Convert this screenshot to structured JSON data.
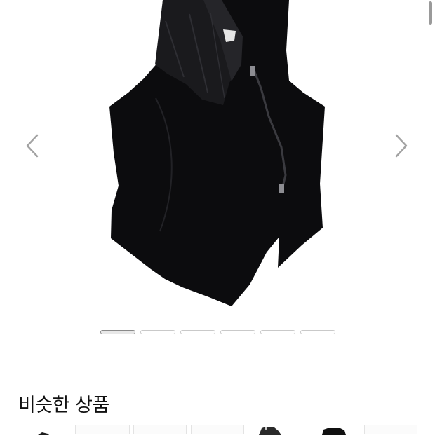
{
  "colors": {
    "garment": "#0c0c0e",
    "background": "#ffffff",
    "indicator_active": "#8a8a8a",
    "indicator_inactive": "#c9c9c9"
  },
  "carousel": {
    "prev_icon": "chevron-left-icon",
    "next_icon": "chevron-right-icon",
    "slide_count": 6,
    "active_slide": 1
  },
  "similar_products": {
    "title": "비슷한 상품"
  }
}
